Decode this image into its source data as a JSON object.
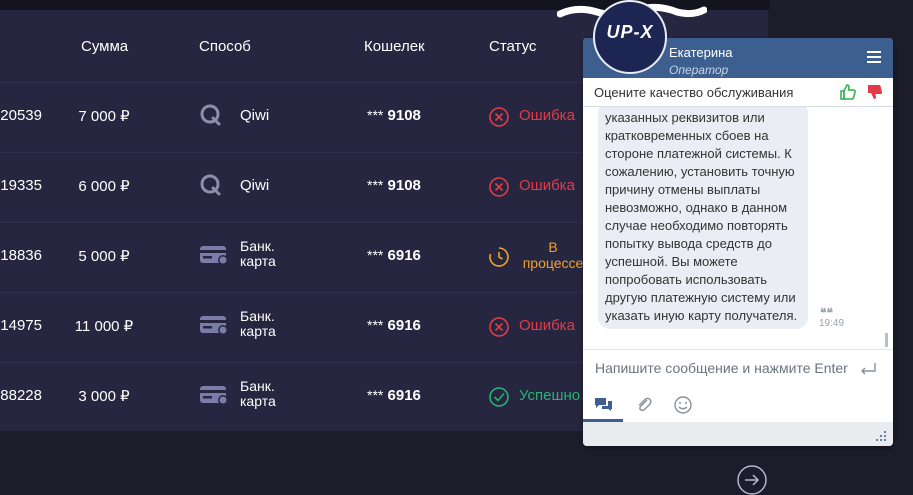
{
  "table": {
    "headers": {
      "amount": "Сумма",
      "method": "Способ",
      "wallet": "Кошелек",
      "status": "Статус"
    },
    "rows": [
      {
        "id": "20539",
        "amount": "7 000 ₽",
        "method": "Qiwi",
        "wallet_mask": "***",
        "wallet_last": "9108",
        "status": "Ошибка",
        "status_type": "error"
      },
      {
        "id": "19335",
        "amount": "6 000 ₽",
        "method": "Qiwi",
        "wallet_mask": "***",
        "wallet_last": "9108",
        "status": "Ошибка",
        "status_type": "error"
      },
      {
        "id": "18836",
        "amount": "5 000 ₽",
        "method_line1": "Банк.",
        "method_line2": "карта",
        "wallet_mask": "***",
        "wallet_last": "6916",
        "status_line1": "В",
        "status_line2": "процессе",
        "status_type": "pending"
      },
      {
        "id": "14975",
        "amount": "11 000 ₽",
        "method_line1": "Банк.",
        "method_line2": "карта",
        "wallet_mask": "***",
        "wallet_last": "6916",
        "status": "Ошибка",
        "status_type": "error"
      },
      {
        "id": "88228",
        "amount": "3 000 ₽",
        "method_line1": "Банк.",
        "method_line2": "карта",
        "wallet_mask": "***",
        "wallet_last": "6916",
        "status": "Успешно",
        "status_type": "success"
      }
    ]
  },
  "chat": {
    "avatar_label": "UP-X",
    "operator_name": "Екатерина",
    "operator_role": "Оператор",
    "rate_prompt": "Оцените качество обслуживания",
    "message_text": "указанных реквизитов или кратковременных сбоев на стороне платежной системы. К сожалению, установить точную причину отмены выплаты невозможно, однако в данном случае необходимо повторять попытку вывода средств до успешной. Вы можете попробовать использовать другую платежную систему или указать иную карту получателя.",
    "message_time": "19:49",
    "input_placeholder": "Напишите сообщение и нажмите Enter"
  },
  "colors": {
    "error": "#e23b48",
    "success": "#23b574",
    "pending": "#f1a226",
    "chat_header": "#3d5f90"
  },
  "icons": {
    "qiwi": "qiwi-icon",
    "bank_card": "bank-card-icon",
    "error": "error-circle-icon",
    "pending": "clock-icon",
    "success": "check-circle-icon",
    "next": "arrow-right-circle-icon"
  }
}
